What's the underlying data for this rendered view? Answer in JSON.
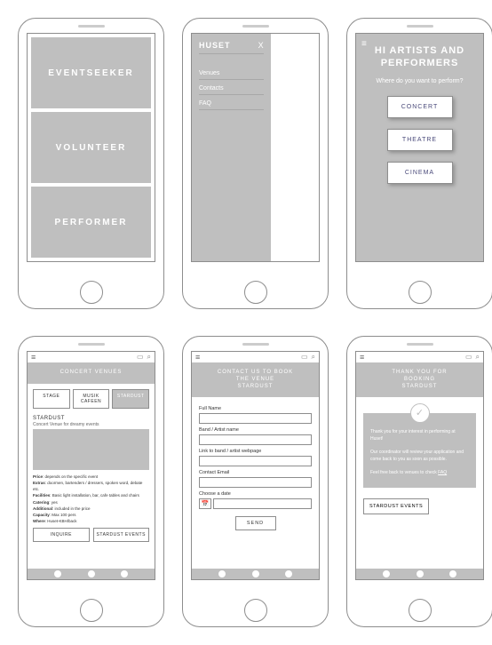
{
  "screen1": {
    "tiles": [
      "EVENTSEEKER",
      "VOLUNTEER",
      "PERFORMER"
    ]
  },
  "screen2": {
    "logo": "HUSET",
    "close": "X",
    "items": [
      "Venues",
      "Contacts",
      "FAQ"
    ]
  },
  "screen3": {
    "title": "HI ARTISTS AND PERFORMERS",
    "subtitle": "Where do you want to perform?",
    "buttons": [
      "CONCERT",
      "THEATRE",
      "CINEMA"
    ]
  },
  "screen4": {
    "header": "CONCERT VENUES",
    "filters": [
      {
        "label": "STAGE",
        "active": false
      },
      {
        "label": "MUSIK CAFEEN",
        "active": false
      },
      {
        "label": "STARDUST",
        "active": true
      }
    ],
    "venue_title": "STARDUST",
    "venue_sub": "Concert Venue for dreamy events",
    "details": [
      {
        "k": "Price",
        "v": "depends on the specific event"
      },
      {
        "k": "Extras",
        "v": "doormen, bartenders / dressers, spoken word, debate etc."
      },
      {
        "k": "Facilities",
        "v": "Basic light installation, bar, cafe tables and chairs"
      },
      {
        "k": "Catering",
        "v": "yes"
      },
      {
        "k": "Additional",
        "v": "included in the price"
      },
      {
        "k": "Capacity",
        "v": "Max 100 pers"
      },
      {
        "k": "Where",
        "v": "Huset-KBH/back"
      }
    ],
    "btn_inquire": "INQUIRE",
    "btn_events": "STARDUST EVENTS"
  },
  "screen5": {
    "header_line1": "Contact us to book",
    "header_line2": "the venue",
    "header_line3": "STARDUST",
    "fields": {
      "name": "Full Name",
      "band": "Band / Artist name",
      "link": "Link to band / artist webpage",
      "email": "Contact Email",
      "date": "Choose a date"
    },
    "date_icon": "📅",
    "send": "SEND"
  },
  "screen6": {
    "header_line1": "Thank you for",
    "header_line2": "booking",
    "header_line3": "STARDUST",
    "check": "✓",
    "p1": "Thank you for your interest in performing at Huset!",
    "p2a": "Our coordinator will review your application and come back to you as soon as possible.",
    "p3a": "Feel free back to venues to check ",
    "p3_link": "FAQ",
    "btn": "STARDUST EVENTS"
  }
}
